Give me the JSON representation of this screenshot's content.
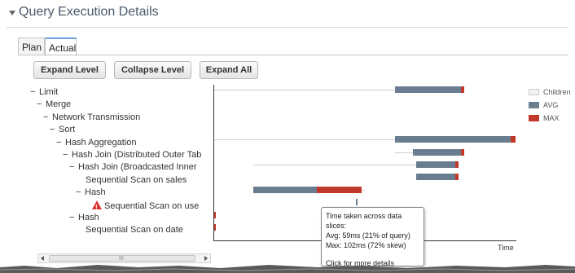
{
  "header": {
    "title": "Query Execution Details"
  },
  "tabs": [
    {
      "label": "Plan"
    },
    {
      "label": "Actual"
    }
  ],
  "buttons": {
    "expand_level": "Expand Level",
    "collapse_level": "Collapse Level",
    "expand_all": "Expand All"
  },
  "tree": [
    {
      "prefix": "−",
      "label": "Limit"
    },
    {
      "prefix": "−",
      "label": "Merge"
    },
    {
      "prefix": "−",
      "label": "Network Transmission"
    },
    {
      "prefix": "−",
      "label": "Sort"
    },
    {
      "prefix": "−",
      "label": "Hash Aggregation"
    },
    {
      "prefix": "−",
      "label": "Hash Join (Distributed Outer Tab"
    },
    {
      "prefix": "−",
      "label": "Hash Join (Broadcasted Inner"
    },
    {
      "prefix": "",
      "label": "Sequential Scan on sales"
    },
    {
      "prefix": "−",
      "label": "Hash"
    },
    {
      "prefix": "",
      "label": "Sequential Scan on use",
      "warning": true
    },
    {
      "prefix": "−",
      "label": "Hash"
    },
    {
      "prefix": "",
      "label": "Sequential Scan on date"
    }
  ],
  "chart_data": {
    "type": "bar",
    "orientation": "horizontal-timeline",
    "xlabel": "Time",
    "legend": [
      {
        "name": "Children",
        "color": "#f2f2f2"
      },
      {
        "name": "AVG",
        "color": "#6a7d90"
      },
      {
        "name": "MAX",
        "color": "#c0392b"
      }
    ],
    "legend_position": "right",
    "rows": [
      {
        "children": [
          0.0,
          0.83
        ],
        "avg": [
          0.6,
          0.82
        ],
        "max": [
          0.82,
          0.83
        ]
      },
      {
        "children": [
          0,
          0
        ],
        "avg": [
          0,
          0
        ],
        "max": [
          0,
          0
        ]
      },
      {
        "children": [
          0,
          0
        ],
        "avg": [
          0,
          0
        ],
        "max": [
          0,
          0
        ]
      },
      {
        "children": [
          0,
          0
        ],
        "avg": [
          0,
          0
        ],
        "max": [
          0,
          0
        ]
      },
      {
        "children": [
          0.0,
          1.0
        ],
        "avg": [
          0.6,
          0.985
        ],
        "max": [
          0.985,
          1.0
        ]
      },
      {
        "children": [
          0.6,
          0.83
        ],
        "avg": [
          0.66,
          0.82
        ],
        "max": [
          0.82,
          0.83
        ]
      },
      {
        "children": [
          0.13,
          0.81
        ],
        "avg": [
          0.67,
          0.81
        ],
        "max": [
          0.8,
          0.81
        ]
      },
      {
        "children": [
          0,
          0
        ],
        "avg": [
          0.67,
          0.8
        ],
        "max": [
          0.8,
          0.81
        ]
      },
      {
        "children": [
          0.13,
          0.5
        ],
        "avg": [
          0.13,
          0.34
        ],
        "max": [
          0.34,
          0.49
        ]
      },
      {
        "children": [
          0,
          0
        ],
        "avg": [
          0.47,
          0.475
        ],
        "max": [
          0,
          0
        ]
      },
      {
        "children": [
          0,
          0
        ],
        "avg": [
          0,
          0
        ],
        "max": [
          0.0,
          0.005
        ]
      },
      {
        "children": [
          0,
          0
        ],
        "avg": [
          0,
          0
        ],
        "max": [
          0.0,
          0.005
        ]
      }
    ]
  },
  "tooltip": {
    "line1": "Time taken across data slices:",
    "line2": "Avg: 59ms (21% of query)",
    "line3": "Max: 102ms (72% skew)",
    "line4": "Click for more details"
  },
  "scrollbar": {
    "grip": "III"
  }
}
